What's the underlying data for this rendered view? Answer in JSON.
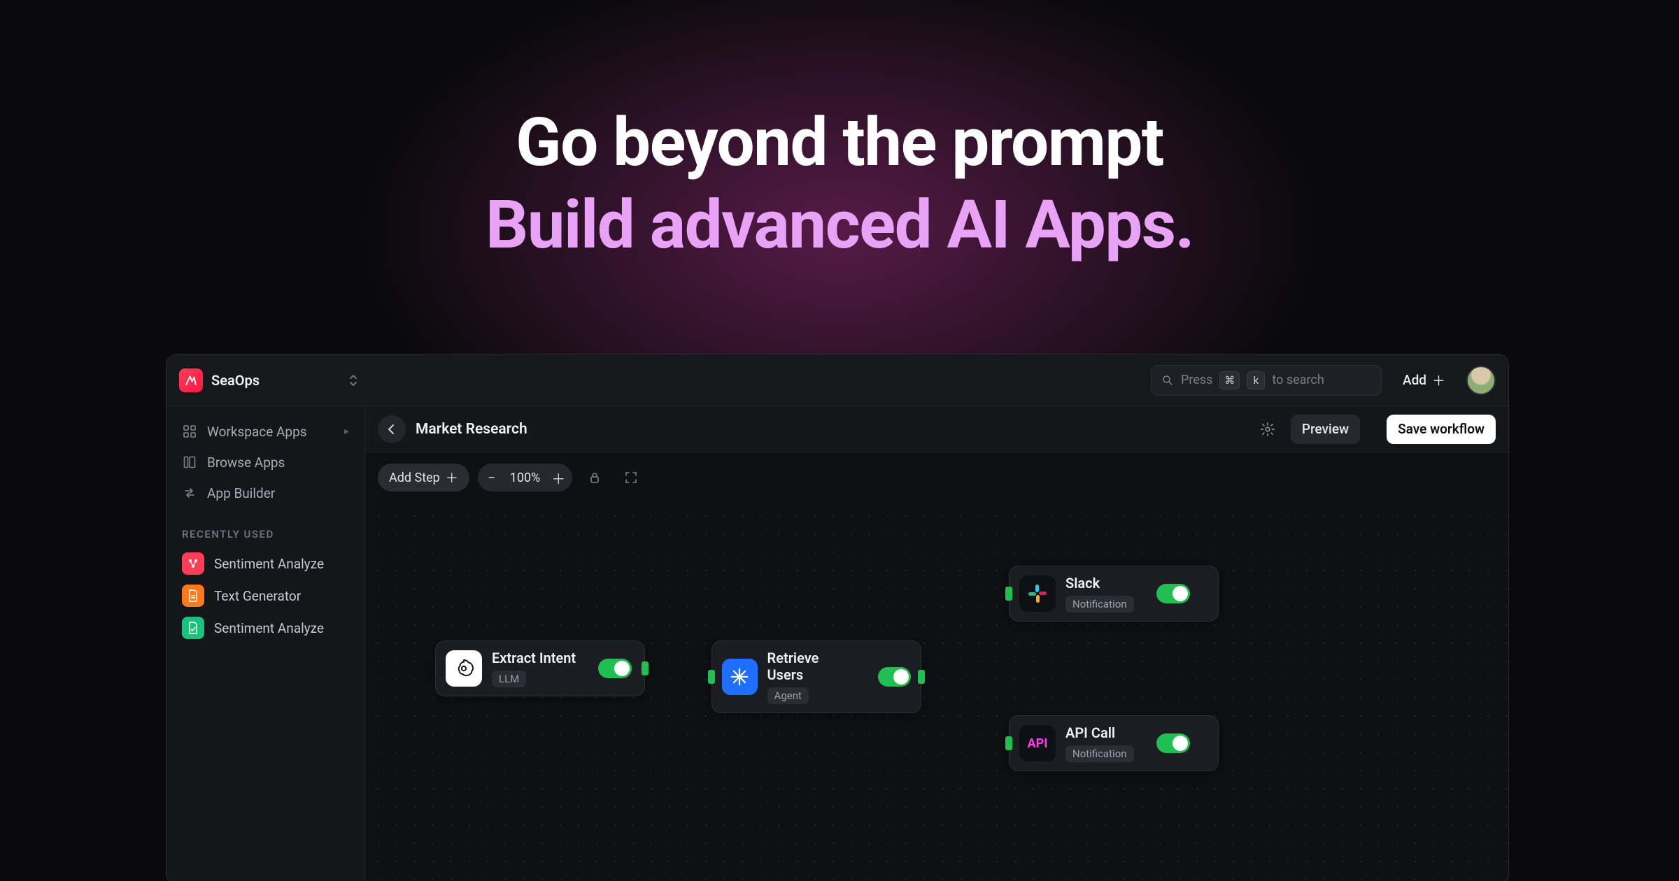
{
  "hero": {
    "line1": "Go beyond the prompt",
    "line2": "Build advanced AI Apps."
  },
  "topbar": {
    "org_name": "SeaOps",
    "search_prefix": "Press",
    "search_key1": "⌘",
    "search_key2": "k",
    "search_suffix": "to search",
    "add_label": "Add"
  },
  "sidebar": {
    "nav": [
      {
        "label": "Workspace Apps",
        "icon": "grid"
      },
      {
        "label": "Browse Apps",
        "icon": "layout"
      },
      {
        "label": "App Builder",
        "icon": "swap"
      }
    ],
    "recent_label": "RECENTLY USED",
    "recent": [
      {
        "label": "Sentiment Analyze",
        "color": "ic-red"
      },
      {
        "label": "Text Generator",
        "color": "ic-orange"
      },
      {
        "label": "Sentiment Analyze",
        "color": "ic-green"
      }
    ]
  },
  "main": {
    "title": "Market Research",
    "preview": "Preview",
    "save": "Save workflow"
  },
  "toolbar": {
    "add_step": "Add Step",
    "zoom": "100%"
  },
  "nodes": {
    "n1": {
      "title": "Extract Intent",
      "tag": "LLM"
    },
    "n2": {
      "title": "Retrieve Users",
      "tag": "Agent"
    },
    "n3": {
      "title": "Slack",
      "tag": "Notification"
    },
    "n4": {
      "title": "API Call",
      "tag": "Notification",
      "icon_text": "API"
    }
  }
}
